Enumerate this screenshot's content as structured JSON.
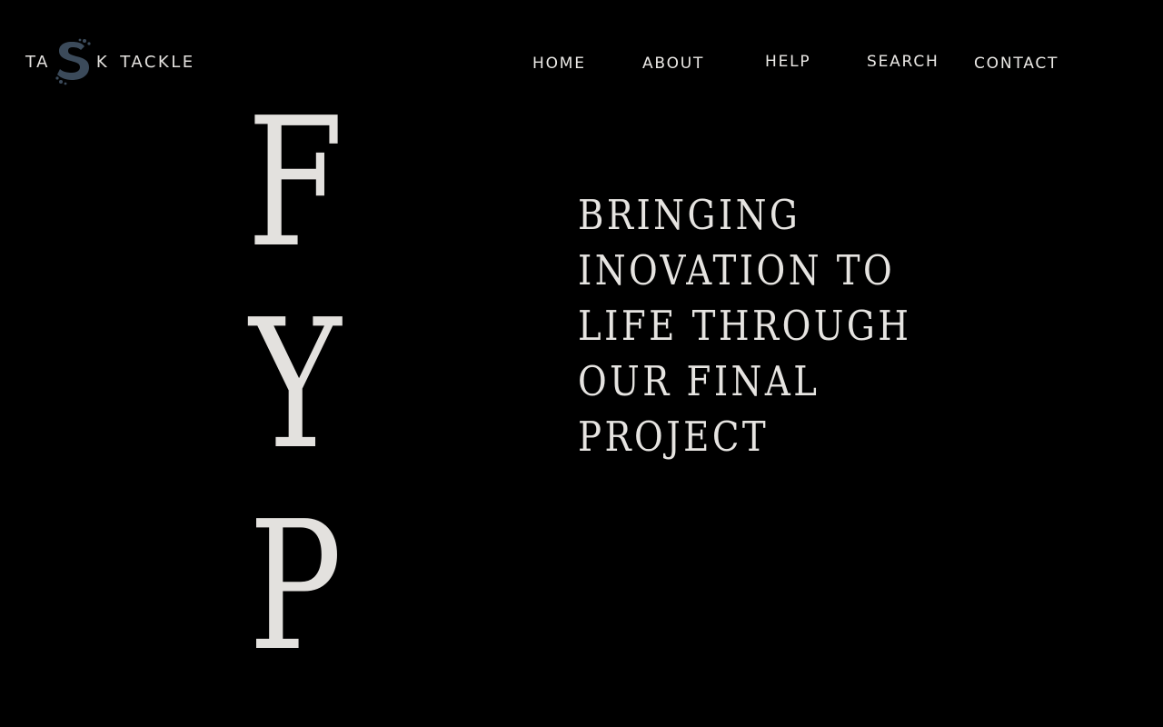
{
  "brand": {
    "prefix": "TA",
    "mark_icon": "s-letter-logo-icon",
    "suffix_letter": "K",
    "suffix_word": "TACKLE",
    "mark_color": "#3b4a5a"
  },
  "nav": {
    "items": [
      {
        "label": "HOME"
      },
      {
        "label": "ABOUT"
      },
      {
        "label": "HELP"
      },
      {
        "label": "SEARCH"
      },
      {
        "label": "CONTACT"
      }
    ]
  },
  "hero": {
    "letters": [
      "F",
      "Y",
      "P"
    ],
    "tagline_lines": [
      "BRINGING",
      "INOVATION TO",
      "LIFE THROUGH",
      "OUR FINAL",
      "PROJECT"
    ]
  },
  "colors": {
    "background": "#000000",
    "text": "#e4e2df"
  }
}
